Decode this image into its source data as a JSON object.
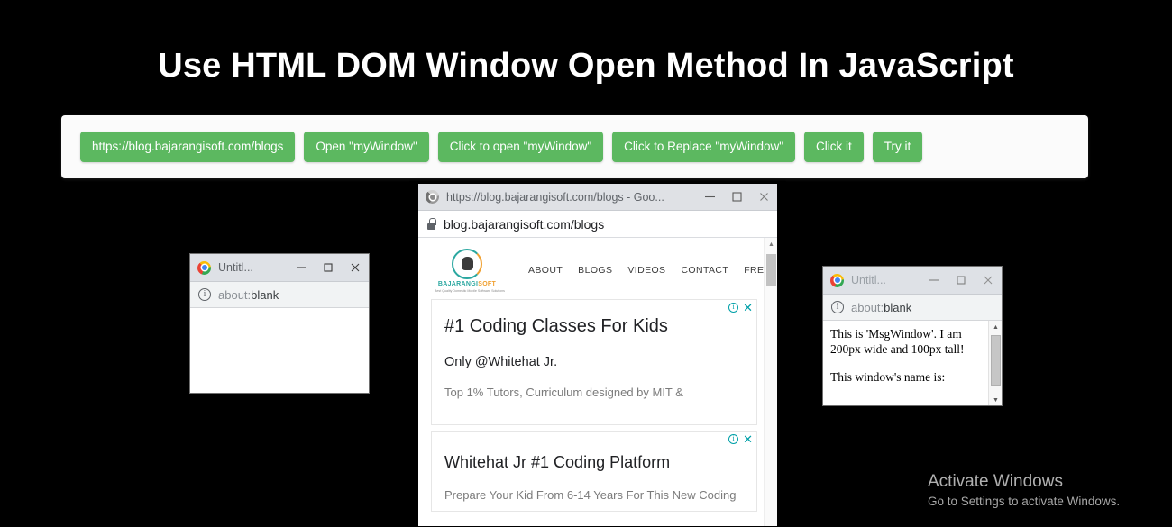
{
  "page": {
    "title": "Use HTML DOM Window Open Method In JavaScript",
    "background_color": "#000000",
    "accent_color": "#5cb860"
  },
  "toolbar": {
    "panel_background": "#fbfbfb",
    "buttons": [
      {
        "label": "https://blog.bajarangisoft.com/blogs"
      },
      {
        "label": "Open \"myWindow\""
      },
      {
        "label": "Click to open \"myWindow\""
      },
      {
        "label": "Click to Replace \"myWindow\""
      },
      {
        "label": "Click it"
      },
      {
        "label": "Try it"
      }
    ]
  },
  "popup_left": {
    "title": "Untitl...",
    "url_prefix": "about:",
    "url_rest": "blank",
    "minimize": "—",
    "maximize": "□",
    "close": "✕",
    "body_text": ""
  },
  "popup_right": {
    "title": "Untitl...",
    "url_prefix": "about:",
    "url_rest": "blank",
    "minimize": "—",
    "maximize": "□",
    "close": "✕",
    "message_line_1": "This is 'MsgWindow'. I am 200px wide and 100px tall!",
    "message_line_2": "This window's name is:"
  },
  "browser_main": {
    "title": "https://blog.bajarangisoft.com/blogs - Goo...",
    "url_text": "blog.bajarangisoft.com/blogs",
    "minimize": "—",
    "maximize": "□",
    "close": "✕",
    "site": {
      "logo_word_1": "BAJARANGI",
      "logo_word_2": "SOFT",
      "logo_tagline": "Best Quality Domestic Mopile Software Solutions",
      "nav": [
        "ABOUT",
        "BLOGS",
        "VIDEOS",
        "CONTACT",
        "FREE DESIGN"
      ]
    },
    "ads": [
      {
        "title": "#1 Coding Classes For Kids",
        "subtitle": "Only @Whitehat Jr.",
        "description": "Top 1% Tutors, Curriculum designed by MIT &",
        "info_label": "i",
        "close_label": "✕"
      },
      {
        "title": "Whitehat Jr #1 Coding Platform",
        "description": "Prepare Your Kid From 6-14 Years For This New Coding",
        "info_label": "i",
        "close_label": "✕"
      }
    ]
  },
  "watermark": {
    "title": "Activate Windows",
    "subtitle": "Go to Settings to activate Windows."
  }
}
